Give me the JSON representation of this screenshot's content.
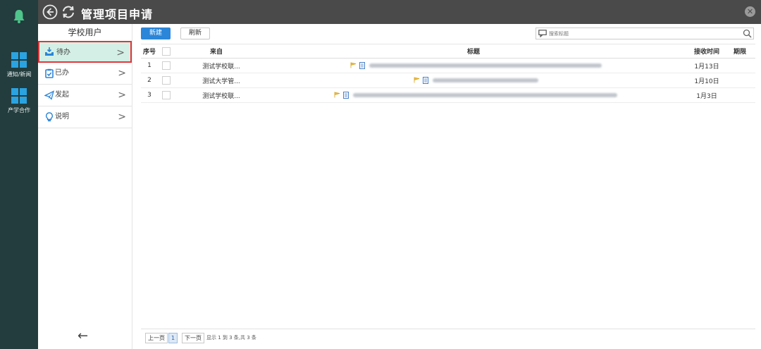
{
  "rail": {
    "apps": [
      {
        "label": "通知/新闻"
      },
      {
        "label": "产学合作"
      }
    ]
  },
  "titlebar": {
    "title": "管理项目申请",
    "close_glyph": "✕"
  },
  "sidemenu": {
    "user": "学校用户",
    "items": [
      {
        "label": "待办",
        "icon": "inbox-tray-icon",
        "active": true
      },
      {
        "label": "已办",
        "icon": "clipboard-check-icon"
      },
      {
        "label": "发起",
        "icon": "send-plane-icon"
      },
      {
        "label": "说明",
        "icon": "lightbulb-icon"
      }
    ],
    "chevron": ">",
    "back_glyph": "←"
  },
  "toolbar": {
    "new_label": "新建",
    "refresh_label": "刷新",
    "search_placeholder": "搜索标题"
  },
  "table": {
    "headers": {
      "index": "序号",
      "from": "来自",
      "subject": "标题",
      "received": "接收时间",
      "deadline": "期限"
    },
    "rows": [
      {
        "index": "1",
        "from": "测试学校联...",
        "received": "1月13日",
        "deadline": ""
      },
      {
        "index": "2",
        "from": "测试大学管...",
        "received": "1月10日",
        "deadline": ""
      },
      {
        "index": "3",
        "from": "测试学校联...",
        "received": "1月3日",
        "deadline": ""
      }
    ]
  },
  "pager": {
    "prev": "上一页",
    "page": "1",
    "next": "下一页",
    "info": "显示 1 到 3 条,共 3 条"
  },
  "colors": {
    "rail": "#233c3d",
    "titlebar": "#4a4a4a",
    "accent": "#2b85d8",
    "active_bg": "#d4f0e6",
    "active_border": "#e0363b",
    "windows_tile": "#2aa3e0",
    "bell": "#4fc48b"
  }
}
